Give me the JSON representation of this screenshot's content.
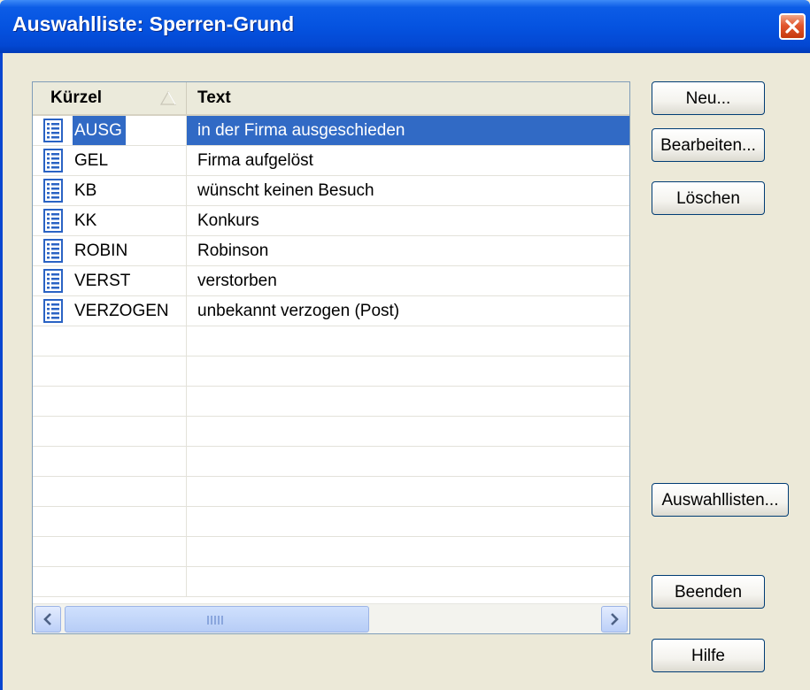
{
  "window": {
    "title": "Auswahlliste: Sperren-Grund"
  },
  "list": {
    "columns": {
      "kuerzel": "Kürzel",
      "text": "Text"
    },
    "rows": [
      {
        "kuerzel": "AUSG",
        "text": "in der Firma ausgeschieden",
        "selected": true
      },
      {
        "kuerzel": "GEL",
        "text": "Firma aufgelöst"
      },
      {
        "kuerzel": "KB",
        "text": "wünscht keinen Besuch"
      },
      {
        "kuerzel": "KK",
        "text": "Konkurs"
      },
      {
        "kuerzel": "ROBIN",
        "text": "Robinson"
      },
      {
        "kuerzel": "VERST",
        "text": "verstorben"
      },
      {
        "kuerzel": "VERZOGEN",
        "text": "unbekannt verzogen (Post)"
      }
    ]
  },
  "buttons": {
    "neu": "Neu...",
    "bearbeiten": "Bearbeiten...",
    "loeschen": "Löschen",
    "auswahllisten": "Auswahllisten...",
    "beenden": "Beenden",
    "hilfe": "Hilfe"
  },
  "icons": {
    "close": "close-icon",
    "row": "list-document-icon",
    "sort": "sort-ascending-icon"
  },
  "colors": {
    "selection": "#316ac5",
    "titlebar": "#0553e0",
    "close": "#e2562e"
  }
}
